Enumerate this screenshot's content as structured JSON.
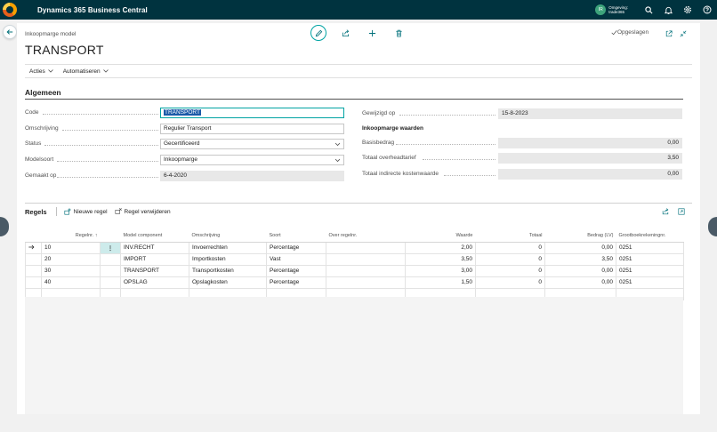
{
  "topbar": {
    "app_title": "Dynamics 365 Business Central",
    "environment_label": "Omgeving:",
    "environment_name": "trade365",
    "avatar_initials": "IR"
  },
  "page": {
    "kind": "Inkoopmarge model",
    "title": "TRANSPORT",
    "saved_label": "Opgeslagen"
  },
  "actions": {
    "acties": "Acties",
    "automatiseren": "Automatiseren"
  },
  "general": {
    "section_title": "Algemeen",
    "code_label": "Code",
    "code_value": "TRANSPORT",
    "omschrijving_label": "Omschrijving",
    "omschrijving_value": "Regulier Transport",
    "status_label": "Status",
    "status_value": "Gecertificeerd",
    "modelsoort_label": "Modelsoort",
    "modelsoort_value": "Inkoopmarge",
    "gemaakt_label": "Gemaakt op",
    "gemaakt_value": "6-4-2020",
    "gewijzigd_label": "Gewijzigd op",
    "gewijzigd_value": "15-8-2023",
    "inkoopmarge_waarden": "Inkoopmarge waarden",
    "basisbedrag_label": "Basisbedrag",
    "basisbedrag_value": "0,00",
    "overhead_label": "Totaal overheadtarief",
    "overhead_value": "3,50",
    "indirect_label": "Totaal indirecte kostenwaarde",
    "indirect_value": "0,00"
  },
  "regels": {
    "title": "Regels",
    "new_line": "Nieuwe regel",
    "delete_line": "Regel verwijderen",
    "columns": [
      "Regelnr. ↑",
      "Model component",
      "Omschrijving",
      "Soort",
      "Over regelnr.",
      "Waarde",
      "Totaal",
      "Bedrag (LV)",
      "Grootboekrekeningnr."
    ],
    "rows": [
      {
        "nr": "10",
        "comp": "INV.RECHT",
        "oms": "Invoerrechten",
        "soort": "Percentage",
        "over": "",
        "waarde": "2,00",
        "totaal": "0",
        "bedrag": "0,00",
        "gb": "0251"
      },
      {
        "nr": "20",
        "comp": "IMPORT",
        "oms": "Importkosten",
        "soort": "Vast",
        "over": "",
        "waarde": "3,50",
        "totaal": "0",
        "bedrag": "3,50",
        "gb": "0251"
      },
      {
        "nr": "30",
        "comp": "TRANSPORT",
        "oms": "Transportkosten",
        "soort": "Percentage",
        "over": "",
        "waarde": "3,00",
        "totaal": "0",
        "bedrag": "0,00",
        "gb": "0251"
      },
      {
        "nr": "40",
        "comp": "OPSLAG",
        "oms": "Opslagkosten",
        "soort": "Percentage",
        "over": "",
        "waarde": "1,50",
        "totaal": "0",
        "bedrag": "0,00",
        "gb": "0251"
      }
    ]
  },
  "colors": {
    "topbar": "#00333f",
    "accent": "#00a3a3",
    "selection": "#1b5aa8"
  },
  "icons": [
    "search-icon",
    "bell-icon",
    "gear-icon",
    "help-icon",
    "back-icon",
    "edit-icon",
    "share-icon",
    "add-icon",
    "delete-icon",
    "checkmark-icon",
    "popout-icon",
    "collapse-icon"
  ]
}
